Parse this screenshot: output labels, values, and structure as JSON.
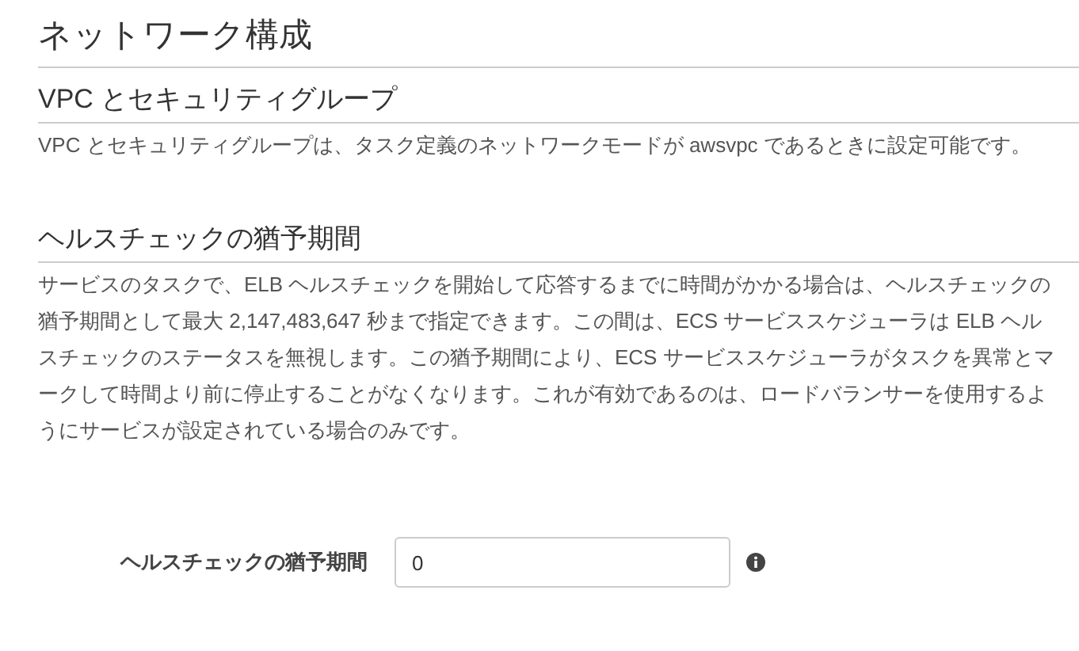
{
  "page_title": "ネットワーク構成",
  "sections": [
    {
      "heading": "VPC とセキュリティグループ",
      "text": "VPC とセキュリティグループは、タスク定義のネットワークモードが awsvpc であるときに設定可能です。"
    },
    {
      "heading": "ヘルスチェックの猶予期間",
      "text": "サービスのタスクで、ELB ヘルスチェックを開始して応答するまでに時間がかかる場合は、ヘルスチェックの猶予期間として最大 2,147,483,647 秒まで指定できます。この間は、ECS サービススケジューラは ELB ヘルスチェックのステータスを無視します。この猶予期間により、ECS サービススケジューラがタスクを異常とマークして時間より前に停止することがなくなります。これが有効であるのは、ロードバランサーを使用するようにサービスが設定されている場合のみです。"
    }
  ],
  "field": {
    "label": "ヘルスチェックの猶予期間",
    "value": "0"
  }
}
